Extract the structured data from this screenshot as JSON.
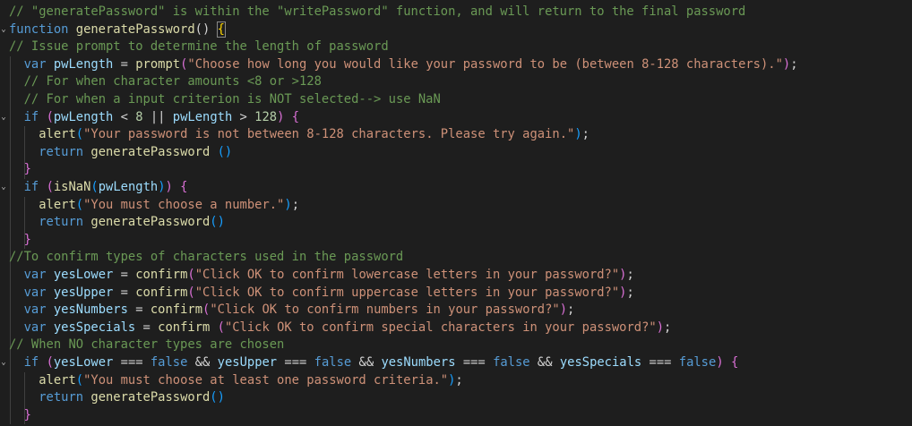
{
  "editor": {
    "fold_arrow": "⌄",
    "lines": [
      [
        {
          "t": "// \"generatePassword\" is within the \"writePassword\" function, and will return to the final password",
          "c": "c"
        }
      ],
      [
        {
          "t": "function",
          "c": "k"
        },
        {
          "t": " ",
          "c": "p"
        },
        {
          "t": "generatePassword",
          "c": "f"
        },
        {
          "t": "() ",
          "c": "p"
        },
        {
          "t": "{",
          "c": "by"
        }
      ],
      [
        {
          "t": "// Issue prompt to determine the length of password",
          "c": "c"
        }
      ],
      [
        {
          "t": "  ",
          "c": "p"
        },
        {
          "t": "var",
          "c": "k"
        },
        {
          "t": " ",
          "c": "p"
        },
        {
          "t": "pwLength",
          "c": "v"
        },
        {
          "t": " = ",
          "c": "p"
        },
        {
          "t": "prompt",
          "c": "f"
        },
        {
          "t": "(",
          "c": "bk"
        },
        {
          "t": "\"Choose how long you would like your password to be (between 8-128 characters).\"",
          "c": "s"
        },
        {
          "t": ")",
          "c": "bk"
        },
        {
          "t": ";",
          "c": "p"
        }
      ],
      [
        {
          "t": "  ",
          "c": "p"
        },
        {
          "t": "// For when character amounts <8 or >128",
          "c": "c"
        }
      ],
      [
        {
          "t": "  ",
          "c": "p"
        },
        {
          "t": "// For when a input criterion is NOT selected--> use NaN",
          "c": "c"
        }
      ],
      [
        {
          "t": "  ",
          "c": "p"
        },
        {
          "t": "if",
          "c": "k"
        },
        {
          "t": " ",
          "c": "p"
        },
        {
          "t": "(",
          "c": "bk"
        },
        {
          "t": "pwLength",
          "c": "v"
        },
        {
          "t": " < ",
          "c": "p"
        },
        {
          "t": "8",
          "c": "n"
        },
        {
          "t": " || ",
          "c": "p"
        },
        {
          "t": "pwLength",
          "c": "v"
        },
        {
          "t": " > ",
          "c": "p"
        },
        {
          "t": "128",
          "c": "n"
        },
        {
          "t": ")",
          "c": "bk"
        },
        {
          "t": " ",
          "c": "p"
        },
        {
          "t": "{",
          "c": "bk"
        }
      ],
      [
        {
          "t": "    ",
          "c": "p"
        },
        {
          "t": "alert",
          "c": "f"
        },
        {
          "t": "(",
          "c": "bb"
        },
        {
          "t": "\"Your password is not between 8-128 characters. Please try again.\"",
          "c": "s"
        },
        {
          "t": ")",
          "c": "bb"
        },
        {
          "t": ";",
          "c": "p"
        }
      ],
      [
        {
          "t": "    ",
          "c": "p"
        },
        {
          "t": "return",
          "c": "k"
        },
        {
          "t": " ",
          "c": "p"
        },
        {
          "t": "generatePassword",
          "c": "f"
        },
        {
          "t": " ",
          "c": "p"
        },
        {
          "t": "()",
          "c": "bb"
        }
      ],
      [
        {
          "t": "  ",
          "c": "p"
        },
        {
          "t": "}",
          "c": "bk"
        }
      ],
      [
        {
          "t": "  ",
          "c": "p"
        },
        {
          "t": "if",
          "c": "k"
        },
        {
          "t": " ",
          "c": "p"
        },
        {
          "t": "(",
          "c": "bk"
        },
        {
          "t": "isNaN",
          "c": "f"
        },
        {
          "t": "(",
          "c": "bb"
        },
        {
          "t": "pwLength",
          "c": "v"
        },
        {
          "t": ")",
          "c": "bb"
        },
        {
          "t": ")",
          "c": "bk"
        },
        {
          "t": " ",
          "c": "p"
        },
        {
          "t": "{",
          "c": "bk"
        }
      ],
      [
        {
          "t": "    ",
          "c": "p"
        },
        {
          "t": "alert",
          "c": "f"
        },
        {
          "t": "(",
          "c": "bb"
        },
        {
          "t": "\"You must choose a number.\"",
          "c": "s"
        },
        {
          "t": ")",
          "c": "bb"
        },
        {
          "t": ";",
          "c": "p"
        }
      ],
      [
        {
          "t": "    ",
          "c": "p"
        },
        {
          "t": "return",
          "c": "k"
        },
        {
          "t": " ",
          "c": "p"
        },
        {
          "t": "generatePassword",
          "c": "f"
        },
        {
          "t": "()",
          "c": "bb"
        }
      ],
      [
        {
          "t": "  ",
          "c": "p"
        },
        {
          "t": "}",
          "c": "bk"
        }
      ],
      [
        {
          "t": "//To confirm types of characters used in the password",
          "c": "c"
        }
      ],
      [
        {
          "t": "  ",
          "c": "p"
        },
        {
          "t": "var",
          "c": "k"
        },
        {
          "t": " ",
          "c": "p"
        },
        {
          "t": "yesLower",
          "c": "v"
        },
        {
          "t": " = ",
          "c": "p"
        },
        {
          "t": "confirm",
          "c": "f"
        },
        {
          "t": "(",
          "c": "bk"
        },
        {
          "t": "\"Click OK to confirm lowercase letters in your password?\"",
          "c": "s"
        },
        {
          "t": ")",
          "c": "bk"
        },
        {
          "t": ";",
          "c": "p"
        }
      ],
      [
        {
          "t": "  ",
          "c": "p"
        },
        {
          "t": "var",
          "c": "k"
        },
        {
          "t": " ",
          "c": "p"
        },
        {
          "t": "yesUpper",
          "c": "v"
        },
        {
          "t": " = ",
          "c": "p"
        },
        {
          "t": "confirm",
          "c": "f"
        },
        {
          "t": "(",
          "c": "bk"
        },
        {
          "t": "\"Click OK to confirm uppercase letters in your password?\"",
          "c": "s"
        },
        {
          "t": ")",
          "c": "bk"
        },
        {
          "t": ";",
          "c": "p"
        }
      ],
      [
        {
          "t": "  ",
          "c": "p"
        },
        {
          "t": "var",
          "c": "k"
        },
        {
          "t": " ",
          "c": "p"
        },
        {
          "t": "yesNumbers",
          "c": "v"
        },
        {
          "t": " = ",
          "c": "p"
        },
        {
          "t": "confirm",
          "c": "f"
        },
        {
          "t": "(",
          "c": "bk"
        },
        {
          "t": "\"Click OK to confirm numbers in your password?\"",
          "c": "s"
        },
        {
          "t": ")",
          "c": "bk"
        },
        {
          "t": ";",
          "c": "p"
        }
      ],
      [
        {
          "t": "  ",
          "c": "p"
        },
        {
          "t": "var",
          "c": "k"
        },
        {
          "t": " ",
          "c": "p"
        },
        {
          "t": "yesSpecials",
          "c": "v"
        },
        {
          "t": " = ",
          "c": "p"
        },
        {
          "t": "confirm",
          "c": "f"
        },
        {
          "t": " ",
          "c": "p"
        },
        {
          "t": "(",
          "c": "bk"
        },
        {
          "t": "\"Click OK to confirm special characters in your password?\"",
          "c": "s"
        },
        {
          "t": ")",
          "c": "bk"
        },
        {
          "t": ";",
          "c": "p"
        }
      ],
      [
        {
          "t": "// When NO character types are chosen",
          "c": "c"
        }
      ],
      [
        {
          "t": "  ",
          "c": "p"
        },
        {
          "t": "if",
          "c": "k"
        },
        {
          "t": " ",
          "c": "p"
        },
        {
          "t": "(",
          "c": "bk"
        },
        {
          "t": "yesLower",
          "c": "v"
        },
        {
          "t": " === ",
          "c": "p"
        },
        {
          "t": "false",
          "c": "k"
        },
        {
          "t": " && ",
          "c": "p"
        },
        {
          "t": "yesUpper",
          "c": "v"
        },
        {
          "t": " === ",
          "c": "p"
        },
        {
          "t": "false",
          "c": "k"
        },
        {
          "t": " && ",
          "c": "p"
        },
        {
          "t": "yesNumbers",
          "c": "v"
        },
        {
          "t": " === ",
          "c": "p"
        },
        {
          "t": "false",
          "c": "k"
        },
        {
          "t": " && ",
          "c": "p"
        },
        {
          "t": "yesSpecials",
          "c": "v"
        },
        {
          "t": " === ",
          "c": "p"
        },
        {
          "t": "false",
          "c": "k"
        },
        {
          "t": ")",
          "c": "bk"
        },
        {
          "t": " ",
          "c": "p"
        },
        {
          "t": "{",
          "c": "bk"
        }
      ],
      [
        {
          "t": "    ",
          "c": "p"
        },
        {
          "t": "alert",
          "c": "f"
        },
        {
          "t": "(",
          "c": "bb"
        },
        {
          "t": "\"You must choose at least one password criteria.\"",
          "c": "s"
        },
        {
          "t": ")",
          "c": "bb"
        },
        {
          "t": ";",
          "c": "p"
        }
      ],
      [
        {
          "t": "    ",
          "c": "p"
        },
        {
          "t": "return",
          "c": "k"
        },
        {
          "t": " ",
          "c": "p"
        },
        {
          "t": "generatePassword",
          "c": "f"
        },
        {
          "t": "()",
          "c": "bb"
        }
      ],
      [
        {
          "t": "  ",
          "c": "p"
        },
        {
          "t": "}",
          "c": "bk"
        }
      ]
    ],
    "folded_lines": [
      1,
      6,
      10,
      20
    ],
    "cursor_brace_line": 1
  }
}
